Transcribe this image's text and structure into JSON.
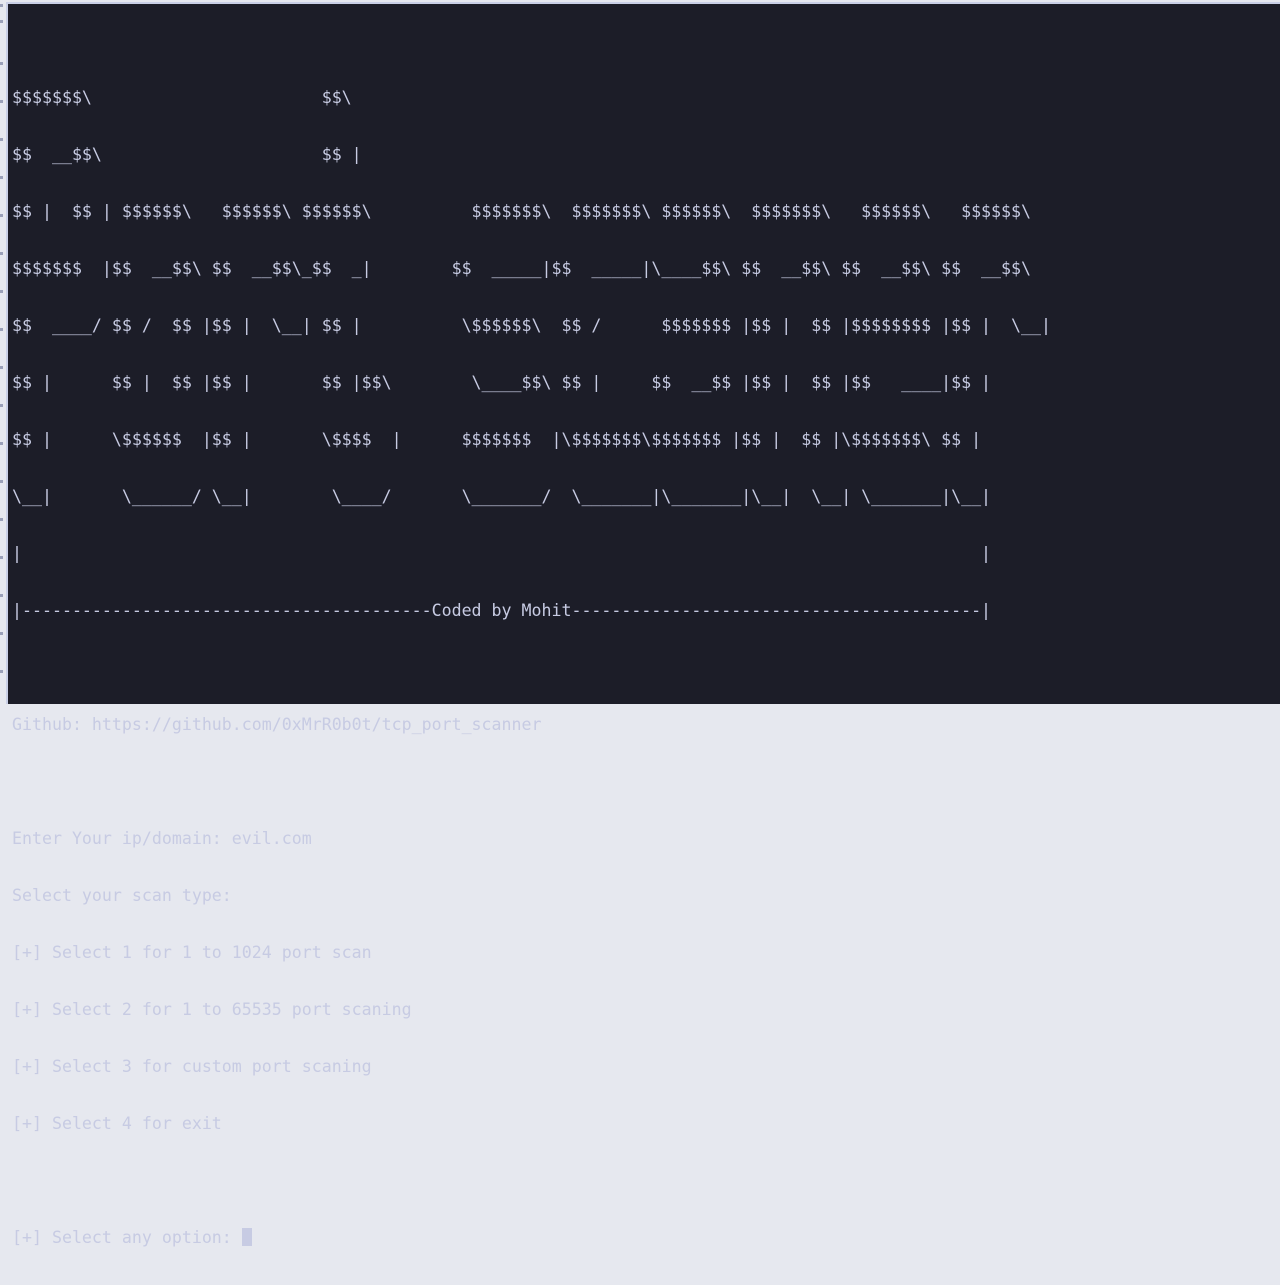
{
  "terminal": {
    "banner": [
      "$$$$$$$\\                       $$\\",
      "$$  __$$\\                      $$ |",
      "$$ |  $$ | $$$$$$\\   $$$$$$\\ $$$$$$\\          $$$$$$$\\  $$$$$$$\\ $$$$$$\\  $$$$$$$\\   $$$$$$\\   $$$$$$\\",
      "$$$$$$$  |$$  __$$\\ $$  __$$\\_$$  _|        $$  _____|$$  _____|\\____$$\\ $$  __$$\\ $$  __$$\\ $$  __$$\\",
      "$$  ____/ $$ /  $$ |$$ |  \\__| $$ |          \\$$$$$$\\  $$ /      $$$$$$$ |$$ |  $$ |$$$$$$$$ |$$ |  \\__|",
      "$$ |      $$ |  $$ |$$ |       $$ |$$\\        \\____$$\\ $$ |     $$  __$$ |$$ |  $$ |$$   ____|$$ |",
      "$$ |      \\$$$$$$  |$$ |       \\$$$$  |      $$$$$$$  |\\$$$$$$$\\$$$$$$$ |$$ |  $$ |\\$$$$$$$\\ $$ |",
      "\\__|       \\______/ \\__|        \\____/       \\_______/  \\_______|\\_______|\\__|  \\__| \\_______|\\__|",
      "|                                                                                                |",
      "|-----------------------------------------Coded by Mohit-----------------------------------------|"
    ],
    "github_line": "Github: https://github.com/0xMrR0b0t/tcp_port_scanner",
    "ip_prompt": "Enter Your ip/domain: evil.com",
    "scan_type_prompt": "Select your scan type:",
    "options": [
      "[+] Select 1 for 1 to 1024 port scan",
      "[+] Select 2 for 1 to 65535 port scaning",
      "[+] Select 3 for custom port scaning",
      "[+] Select 4 for exit"
    ],
    "option_prompt": "[+] Select any option: "
  }
}
